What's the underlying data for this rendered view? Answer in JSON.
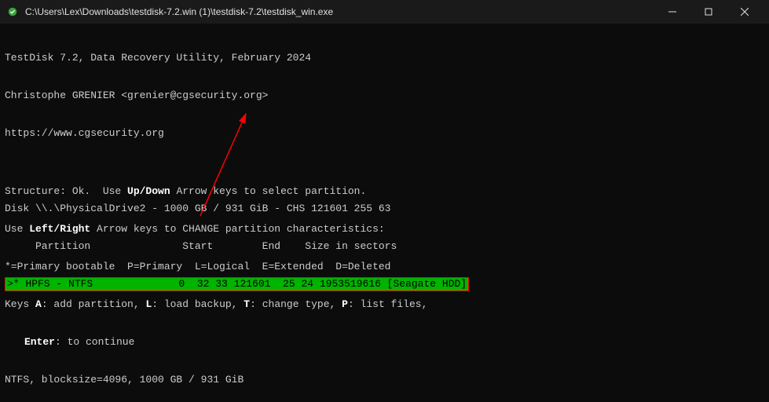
{
  "window": {
    "title": "C:\\Users\\Lex\\Downloads\\testdisk-7.2.win (1)\\testdisk-7.2\\testdisk_win.exe"
  },
  "header": {
    "line1": "TestDisk 7.2, Data Recovery Utility, February 2024",
    "line2": "Christophe GRENIER <grenier@cgsecurity.org>",
    "line3": "https://www.cgsecurity.org"
  },
  "disk": {
    "info": "Disk \\\\.\\PhysicalDrive2 - 1000 GB / 931 GiB - CHS 121601 255 63",
    "columns": "     Partition               Start        End    Size in sectors",
    "row": ">* HPFS - NTFS              0  32 33 121601  25 24 1953519616 [Seagate HDD]"
  },
  "footer": {
    "l1a": "Structure: Ok.  Use ",
    "l1b": "Up/Down",
    "l1c": " Arrow keys to select partition.",
    "l2a": "Use ",
    "l2b": "Left/Right",
    "l2c": " Arrow keys to CHANGE partition characteristics:",
    "l3": "*=Primary bootable  P=Primary  L=Logical  E=Extended  D=Deleted",
    "l4a": "Keys ",
    "l4b": "A",
    "l4c": ": add partition, ",
    "l4d": "L",
    "l4e": ": load backup, ",
    "l4f": "T",
    "l4g": ": change type, ",
    "l4h": "P",
    "l4i": ": list files,",
    "l5a": "Enter",
    "l5b": ": to continue",
    "l6": "NTFS, blocksize=4096, 1000 GB / 931 GiB"
  }
}
